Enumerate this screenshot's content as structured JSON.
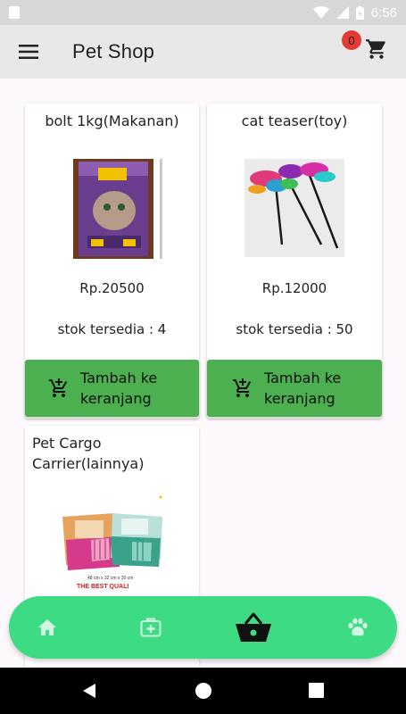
{
  "status_bar": {
    "time": "6:56"
  },
  "app_bar": {
    "title": "Pet Shop",
    "cart_count": "0"
  },
  "products": [
    {
      "title": "bolt 1kg(Makanan)",
      "price": "Rp.20500",
      "stock": "stok tersedia : 4",
      "button_label": "Tambah ke keranjang"
    },
    {
      "title": "cat teaser(toy)",
      "price": "Rp.12000",
      "stock": "stok tersedia : 50",
      "button_label": "Tambah ke keranjang"
    },
    {
      "title": "Pet Cargo Carrier(lainnya)",
      "image_caption": "48 cm x 32 cm x 30 cm",
      "image_tagline": "THE BEST QUALI"
    }
  ],
  "bottom_nav": {
    "items": [
      "home-icon",
      "medical-kit-icon",
      "basket-icon",
      "paw-icon"
    ],
    "accent": "#3ddc84"
  },
  "colors": {
    "button": "#4caf50",
    "badge": "#e53935",
    "appbar": "#e8e8e8"
  }
}
